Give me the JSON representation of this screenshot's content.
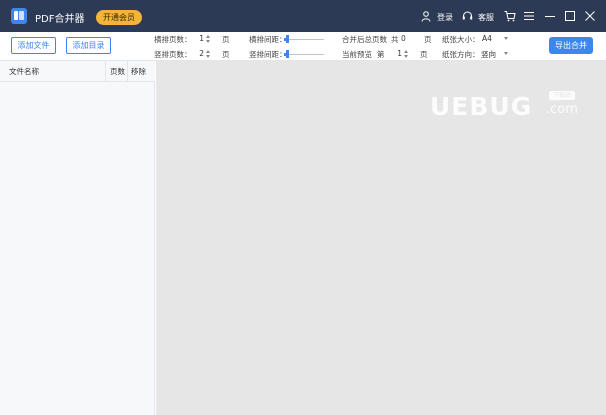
{
  "titlebar": {
    "app_title": "PDF合并器",
    "vip_button": "开通会员",
    "login_label": "登录",
    "service_label": "客服",
    "icons": [
      "user-icon",
      "headset-icon",
      "cart-icon",
      "menu-icon",
      "minimize-icon",
      "maximize-icon",
      "close-icon"
    ]
  },
  "toolbar": {
    "add_file": "添加文件",
    "add_dir": "添加目录",
    "h_pages_label": "横排页数：",
    "h_pages_value": "1",
    "h_pages_unit": "页",
    "v_pages_label": "竖排页数：",
    "v_pages_value": "2",
    "v_pages_unit": "页",
    "h_spacing_label": "横排间距：",
    "v_spacing_label": "竖排间距：",
    "h_spacing_level": 0.05,
    "v_spacing_level": 0.05,
    "merged_pages_label": "合并后总页数",
    "merged_pages_prefix": "共",
    "merged_pages_value": "0",
    "merged_pages_unit": "页",
    "preview_label": "当前预览",
    "preview_prefix": "第",
    "preview_value": "1",
    "preview_unit": "页",
    "paper_size_label": "纸张大小：",
    "paper_size_value": "A4",
    "paper_orient_label": "纸张方向：",
    "paper_orient_value": "竖向",
    "export_button": "导出合并"
  },
  "file_list": {
    "columns": [
      "文件名称",
      "页数",
      "移除"
    ]
  },
  "watermark": {
    "brand": "UEBUG",
    "tag": "下载站",
    "suffix": ".com"
  },
  "colors": {
    "titlebar_bg": "#2c3a55",
    "accent": "#3d86f0",
    "vip": "#f3b43a",
    "preview_bg": "#e6e6e6"
  }
}
